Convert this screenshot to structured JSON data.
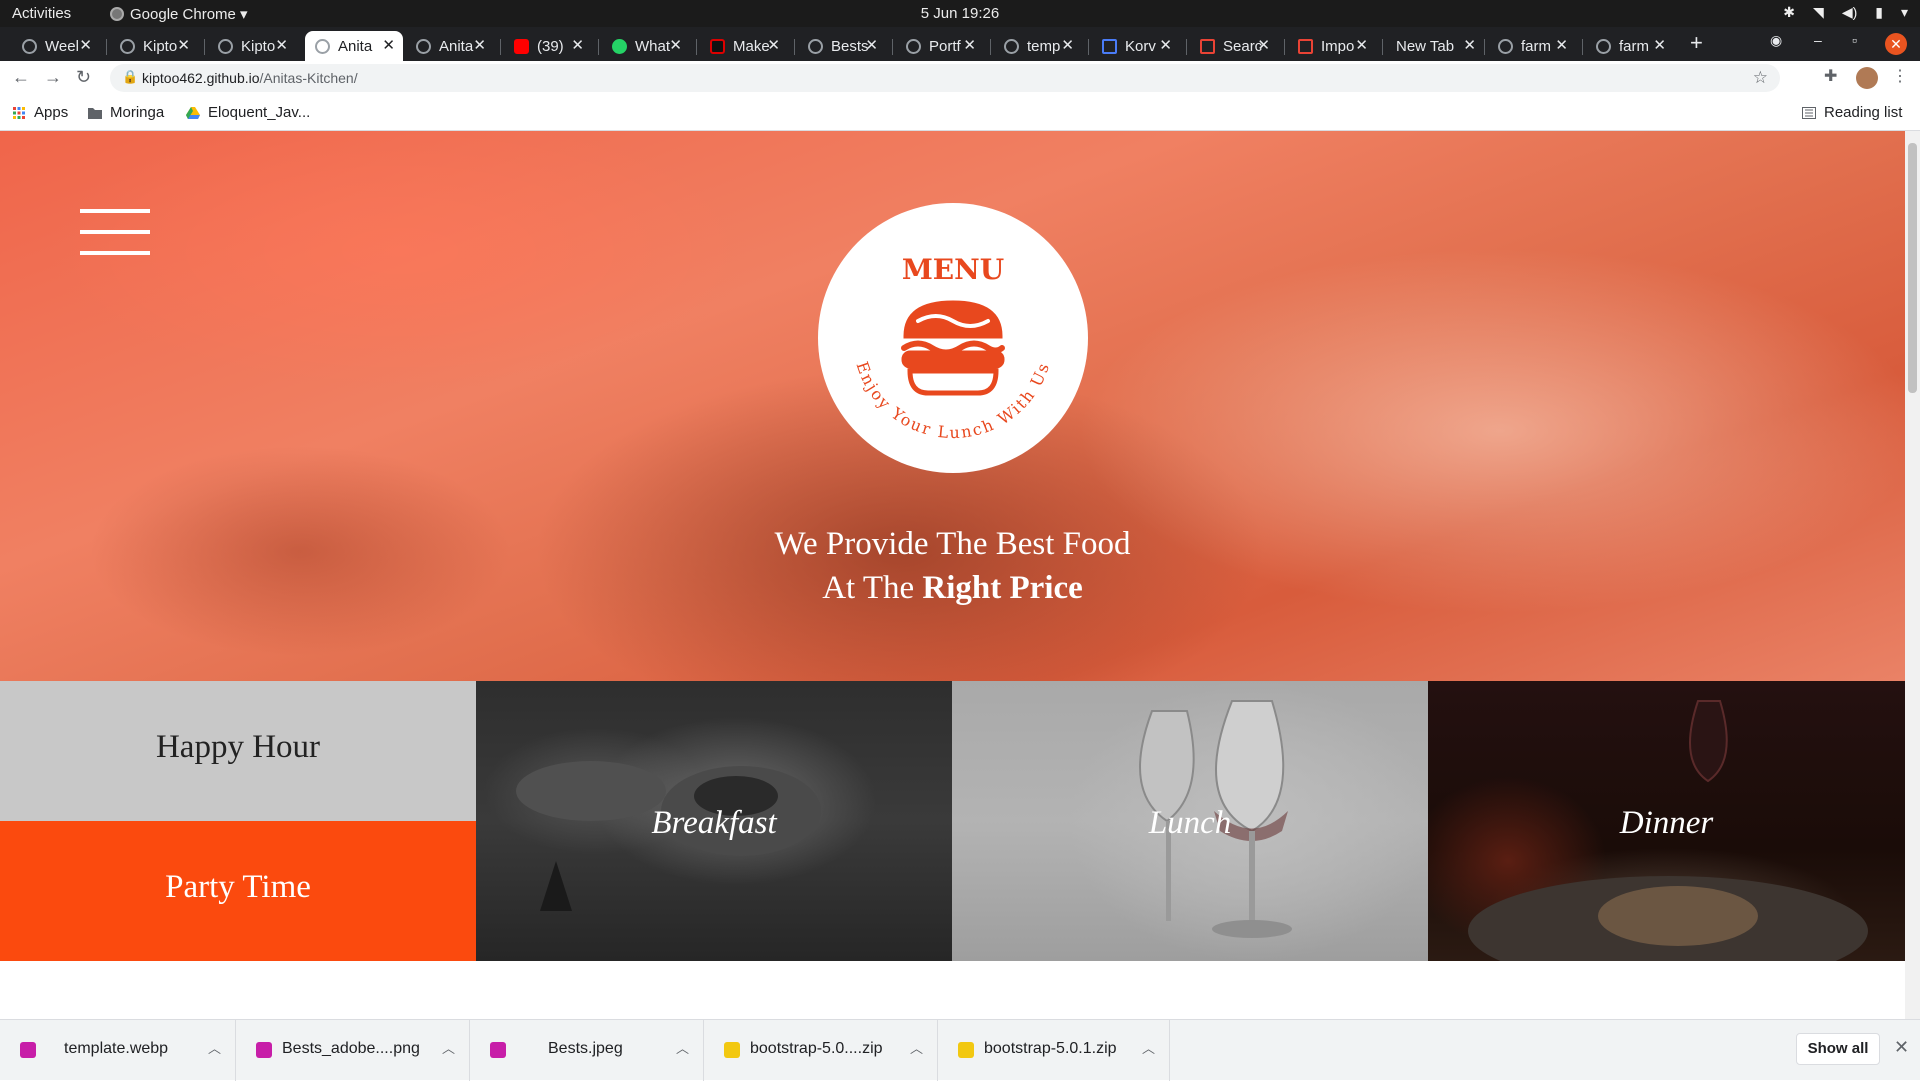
{
  "os": {
    "activities": "Activities",
    "app_name": "Google Chrome ▾",
    "clock": "5 Jun  19:26"
  },
  "tabs": [
    {
      "label": "Weel",
      "active": false
    },
    {
      "label": "Kipto",
      "active": false
    },
    {
      "label": "Kipto",
      "active": false
    },
    {
      "label": "Anita",
      "active": true
    },
    {
      "label": "Anita",
      "active": false
    },
    {
      "label": "(39)",
      "active": false
    },
    {
      "label": "What",
      "active": false
    },
    {
      "label": "Make",
      "active": false
    },
    {
      "label": "Bests",
      "active": false
    },
    {
      "label": "Portf",
      "active": false
    },
    {
      "label": "temp",
      "active": false
    },
    {
      "label": "Korv",
      "active": false
    },
    {
      "label": "Searc",
      "active": false
    },
    {
      "label": "Impo",
      "active": false
    },
    {
      "label": "New Tab",
      "active": false
    },
    {
      "label": "farm",
      "active": false
    },
    {
      "label": "farm",
      "active": false
    }
  ],
  "address": {
    "host": "kiptoo462.github.io",
    "path": "/Anitas-Kitchen/"
  },
  "bookmarks": {
    "apps": "Apps",
    "moringa": "Moringa",
    "eloquent": "Eloquent_Jav...",
    "reading_list": "Reading list"
  },
  "hero": {
    "badge_title": "MENU",
    "badge_arc_text": "Enjoy Your Lunch With Us",
    "slogan_line1": "We Provide The Best Food",
    "slogan_line2_prefix": "At The ",
    "slogan_line2_bold": "Right Price"
  },
  "tiles": {
    "happy_hour": "Happy Hour",
    "party_time": "Party Time",
    "breakfast": "Breakfast",
    "lunch": "Lunch",
    "dinner": "Dinner"
  },
  "downloads": [
    {
      "name": "template.webp",
      "color": "#c71ea8"
    },
    {
      "name": "Bests_adobe....png",
      "color": "#c71ea8"
    },
    {
      "name": "Bests.jpeg",
      "color": "#c71ea8"
    },
    {
      "name": "bootstrap-5.0....zip",
      "color": "#f2c811"
    },
    {
      "name": "bootstrap-5.0.1.zip",
      "color": "#f2c811"
    }
  ],
  "show_all": "Show all",
  "colors": {
    "accent_orange": "#fb4a0e",
    "badge_orange": "#e8481e",
    "happy_hour_bg": "#c8c8c8"
  }
}
